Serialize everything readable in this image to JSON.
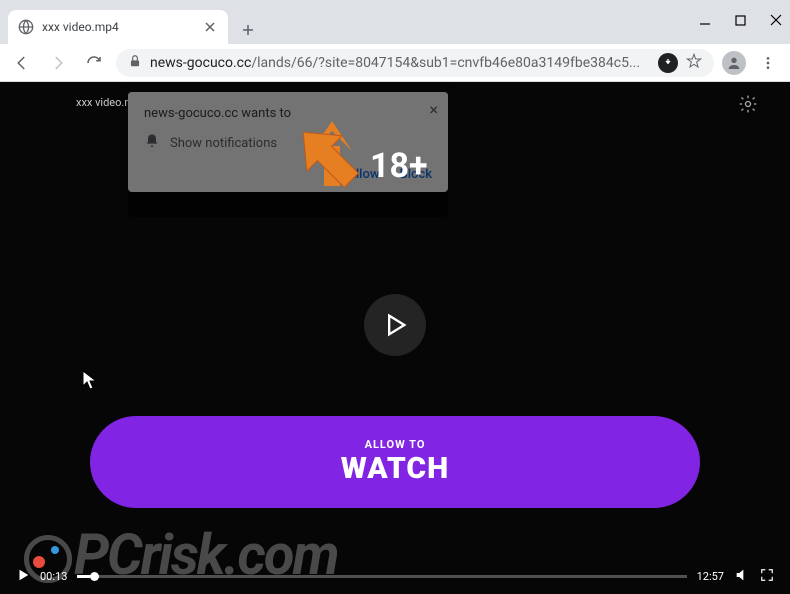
{
  "browser": {
    "tab": {
      "title": "xxx video.mp4"
    },
    "url_host": "news-gocuco.cc",
    "url_path": "/lands/66/?site=8047154&sub1=cnvfb46e80a3149fbe384c5..."
  },
  "page": {
    "small_title": "xxx video.mp4",
    "age_badge": "18+"
  },
  "notification": {
    "prompt": "news-gocuco.cc wants to",
    "body": "Show notifications",
    "allow": "Allow",
    "block": "Block"
  },
  "cta": {
    "line1": "ALLOW TO",
    "line2": "WATCH"
  },
  "video": {
    "elapsed": "00:13",
    "total": "12:57"
  },
  "watermark": {
    "text": "PCrisk.com"
  }
}
